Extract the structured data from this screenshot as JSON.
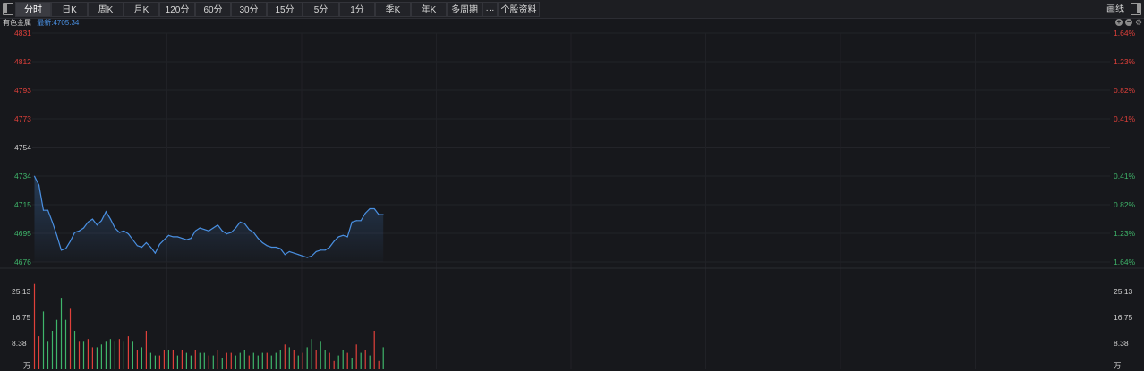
{
  "toolbar": {
    "tabs": [
      "分时",
      "日K",
      "周K",
      "月K",
      "120分",
      "60分",
      "30分",
      "15分",
      "5分",
      "1分",
      "季K",
      "年K",
      "多周期"
    ],
    "more": "···",
    "profile": "个股资料",
    "draw": "画线",
    "active_index": 0
  },
  "info": {
    "name": "有色金属",
    "last_label": "最新:4705.34"
  },
  "colors": {
    "up": "#e0403a",
    "down": "#3fb56a",
    "neutral": "#d0d0d0",
    "line": "#4a90e2",
    "background": "#17181c"
  },
  "chart_data": {
    "type": "line",
    "price_axis": {
      "left_labels": [
        "4831",
        "4812",
        "4793",
        "4773",
        "4754",
        "4734",
        "4715",
        "4695",
        "4676"
      ],
      "right_labels": [
        "1.64%",
        "1.23%",
        "0.82%",
        "0.41%",
        "",
        "0.41%",
        "0.82%",
        "1.23%",
        "1.64%"
      ],
      "label_states": [
        "up",
        "up",
        "up",
        "up",
        "neutral",
        "down",
        "down",
        "down",
        "down"
      ],
      "ylim": [
        4676,
        4831
      ],
      "reference": 4754
    },
    "price_series": [
      4734,
      4728,
      4711,
      4711,
      4703,
      4694,
      4684,
      4685,
      4690,
      4696,
      4697,
      4699,
      4703,
      4705,
      4701,
      4704,
      4710,
      4705,
      4699,
      4696,
      4697,
      4695,
      4691,
      4687,
      4686,
      4689,
      4686,
      4682,
      4688,
      4691,
      4694,
      4693,
      4693,
      4692,
      4691,
      4692,
      4697,
      4699,
      4698,
      4697,
      4699,
      4701,
      4697,
      4695,
      4696,
      4699,
      4703,
      4702,
      4698,
      4696,
      4692,
      4689,
      4687,
      4686,
      4686,
      4685,
      4681,
      4683,
      4682,
      4681,
      4680,
      4679,
      4680,
      4683,
      4684,
      4684,
      4686,
      4690,
      4693,
      4694,
      4693,
      4703,
      4704,
      4704,
      4709,
      4712,
      4712,
      4708,
      4708
    ],
    "volume_axis": {
      "labels": [
        "25.13",
        "16.75",
        "8.38"
      ],
      "unit": "万",
      "max": 33.5
    },
    "volumes": [
      31,
      12,
      21,
      10,
      14,
      18,
      26,
      18,
      22,
      14,
      10,
      10,
      11,
      8,
      8,
      9,
      10,
      11,
      10,
      11,
      10,
      12,
      10,
      7,
      8,
      14,
      6,
      5,
      5,
      7,
      7,
      7,
      5,
      7,
      6,
      5,
      7,
      6,
      6,
      5,
      5,
      7,
      4,
      6,
      6,
      5,
      6,
      7,
      5,
      6,
      5,
      6,
      6,
      5,
      6,
      7,
      9,
      8,
      7,
      5,
      6,
      8,
      11,
      7,
      10,
      7,
      6,
      3,
      5,
      7,
      6,
      4,
      9,
      6,
      7,
      5,
      14,
      3,
      8
    ],
    "volume_states": [
      "up",
      "up",
      "down",
      "down",
      "down",
      "down",
      "down",
      "down",
      "up",
      "down",
      "up",
      "down",
      "up",
      "up",
      "down",
      "down",
      "down",
      "down",
      "down",
      "up",
      "down",
      "up",
      "down",
      "up",
      "down",
      "up",
      "down",
      "down",
      "up",
      "up",
      "down",
      "up",
      "down",
      "up",
      "down",
      "down",
      "up",
      "down",
      "down",
      "up",
      "down",
      "up",
      "down",
      "up",
      "up",
      "down",
      "down",
      "down",
      "up",
      "down",
      "down",
      "down",
      "up",
      "down",
      "down",
      "down",
      "up",
      "down",
      "up",
      "down",
      "up",
      "down",
      "down",
      "up",
      "down",
      "down",
      "up",
      "up",
      "down",
      "down",
      "up",
      "down",
      "up",
      "down",
      "up",
      "down",
      "up",
      "up",
      "down"
    ],
    "total_slots": 241
  }
}
